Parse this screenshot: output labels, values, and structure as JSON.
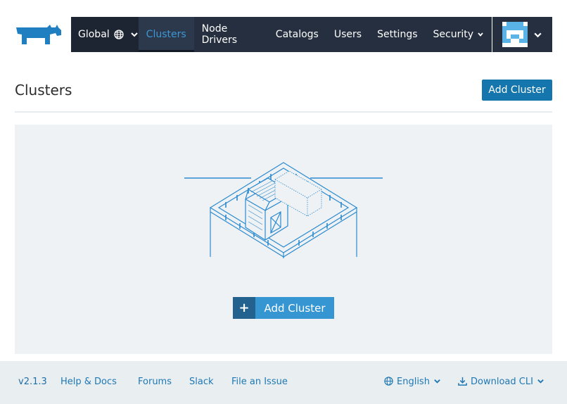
{
  "header": {
    "scope_label": "Global",
    "nav_items": [
      "Clusters",
      "Node Drivers",
      "Catalogs",
      "Users",
      "Settings",
      "Security"
    ],
    "active_item": "Clusters"
  },
  "page": {
    "title": "Clusters",
    "add_button_label": "Add Cluster"
  },
  "empty_state": {
    "add_button_label": "Add Cluster",
    "add_icon": "+"
  },
  "footer": {
    "version": "v2.1.3",
    "links": [
      "Help & Docs",
      "Forums",
      "Slack",
      "File an Issue"
    ],
    "language": "English",
    "download_label": "Download CLI"
  },
  "colors": {
    "nav_bg": "#252f3f",
    "active_link": "#3d98d3",
    "primary_button": "#1476ad",
    "footer_link": "#1f78b4"
  },
  "icons": [
    "rancher-logo",
    "globe-icon",
    "chevron-down-icon",
    "user-avatar",
    "plus-icon",
    "download-icon"
  ]
}
